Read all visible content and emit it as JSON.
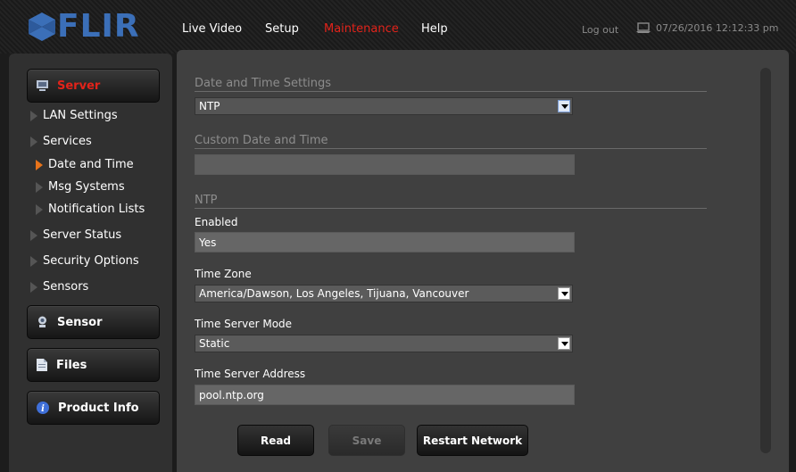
{
  "brand": {
    "name": "FLIR",
    "color": "#3b6fb8",
    "icon": "flir-logo-icon"
  },
  "nav": {
    "items": [
      {
        "label": "Live Video",
        "active": false
      },
      {
        "label": "Setup",
        "active": false
      },
      {
        "label": "Maintenance",
        "active": true
      },
      {
        "label": "Help",
        "active": false
      }
    ],
    "logout": "Log out",
    "datetime": "07/26/2016 12:12:33 pm",
    "clock_icon": "laptop-icon",
    "active_color": "#e2231a"
  },
  "sidebar": {
    "server_button": "Server",
    "server_items": [
      {
        "label": "LAN Settings",
        "level": 1,
        "active": false
      },
      {
        "label": "Services",
        "level": 1,
        "active": false
      },
      {
        "label": "Date and Time",
        "level": 2,
        "active": true
      },
      {
        "label": "Msg Systems",
        "level": 2,
        "active": false
      },
      {
        "label": "Notification Lists",
        "level": 2,
        "active": false
      },
      {
        "label": "Server Status",
        "level": 1,
        "active": false
      },
      {
        "label": "Security Options",
        "level": 1,
        "active": false
      },
      {
        "label": "Sensors",
        "level": 1,
        "active": false
      }
    ],
    "sensor_button": "Sensor",
    "files_button": "Files",
    "product_info_button": "Product Info"
  },
  "main": {
    "date_time_settings_title": "Date and Time Settings",
    "date_time_mode_value": "NTP",
    "custom_date_time_title": "Custom Date and Time",
    "custom_date_time_value": "",
    "ntp_title": "NTP",
    "enabled_label": "Enabled",
    "enabled_value": "Yes",
    "time_zone_label": "Time Zone",
    "time_zone_value": "America/Dawson, Los Angeles, Tijuana, Vancouver",
    "time_server_mode_label": "Time Server Mode",
    "time_server_mode_value": "Static",
    "time_server_address_label": "Time Server Address",
    "time_server_address_value": "pool.ntp.org"
  },
  "actions": {
    "read": "Read",
    "save": "Save",
    "restart": "Restart Network"
  }
}
